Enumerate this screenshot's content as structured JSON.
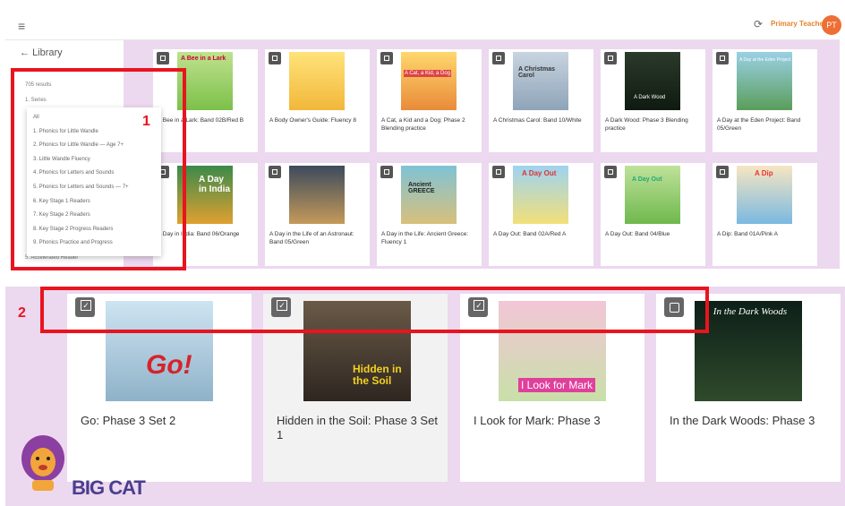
{
  "topbar": {
    "menu_icon": "hamburger-icon",
    "sync_icon": "sync-icon",
    "user_name": "Primary Teacher",
    "avatar_initials": "PT"
  },
  "sidebar": {
    "back_icon": "arrow-left-icon",
    "library_label": "Library",
    "results": "705 results",
    "series_label": "1. Series",
    "accelerated_label": "5. Accelerated Reader",
    "dropdown_items": [
      "All",
      "1. Phonics for Little Wandle",
      "2. Phonics for Little Wandle — Age 7+",
      "3. Little Wandle Fluency",
      "4. Phonics for Letters and Sounds",
      "5. Phonics for Letters and Sounds — 7+",
      "6. Key Stage 1 Readers",
      "7. Key Stage 2 Readers",
      "8. Key Stage 2 Progress Readers",
      "9. Phonics Practice and Progress"
    ]
  },
  "books": [
    {
      "title": "A Bee in a Lark: Band 02B/Red B"
    },
    {
      "title": "A Body Owner's Guide: Fluency 8"
    },
    {
      "title": "A Cat, a Kid and a Dog: Phase 2 Blending practice"
    },
    {
      "title": "A Christmas Carol: Band 10/White"
    },
    {
      "title": "A Dark Wood: Phase 3 Blending practice"
    },
    {
      "title": "A Day at the Eden Project: Band 05/Green"
    },
    {
      "title": "A Day in India: Band 06/Orange"
    },
    {
      "title": "A Day in the Life of an Astronaut: Band 05/Green"
    },
    {
      "title": "A Day in the Life: Ancient Greece: Fluency 1"
    },
    {
      "title": "A Day Out: Band 02A/Red A"
    },
    {
      "title": "A Day Out: Band 04/Blue"
    },
    {
      "title": "A Dip: Band 01A/Pink A"
    }
  ],
  "cover_texts": {
    "c0": "A Bee in a Lark",
    "c2": "A Cat, a Kid, a Dog",
    "c3": "A Christmas Carol",
    "c4": "A Dark Wood",
    "c5": "A Day at the Eden Project",
    "c6": "A Day in India",
    "c8": "Ancient GREECE",
    "c9": "A Day Out",
    "c10": "A Day Out",
    "c11": "A Dip"
  },
  "featured": [
    {
      "title": "Go: Phase 3 Set 2",
      "cover_text": "Go!",
      "checked": true
    },
    {
      "title": "Hidden in the Soil: Phase 3 Set 1",
      "cover_text": "Hidden in the Soil",
      "checked": true
    },
    {
      "title": "I Look for Mark: Phase 3",
      "cover_text": "I Look for Mark",
      "checked": true
    },
    {
      "title": "In the Dark Woods: Phase 3",
      "cover_text": "In the Dark Woods",
      "checked": false
    }
  ],
  "annotations": {
    "one": "1",
    "two": "2"
  },
  "brand": {
    "logo_text": "BIG CAT"
  },
  "colors": {
    "accent": "#e6842b",
    "avatar": "#ee6e33",
    "shelf": "#ecd8ef",
    "annotation": "#e8141e"
  }
}
